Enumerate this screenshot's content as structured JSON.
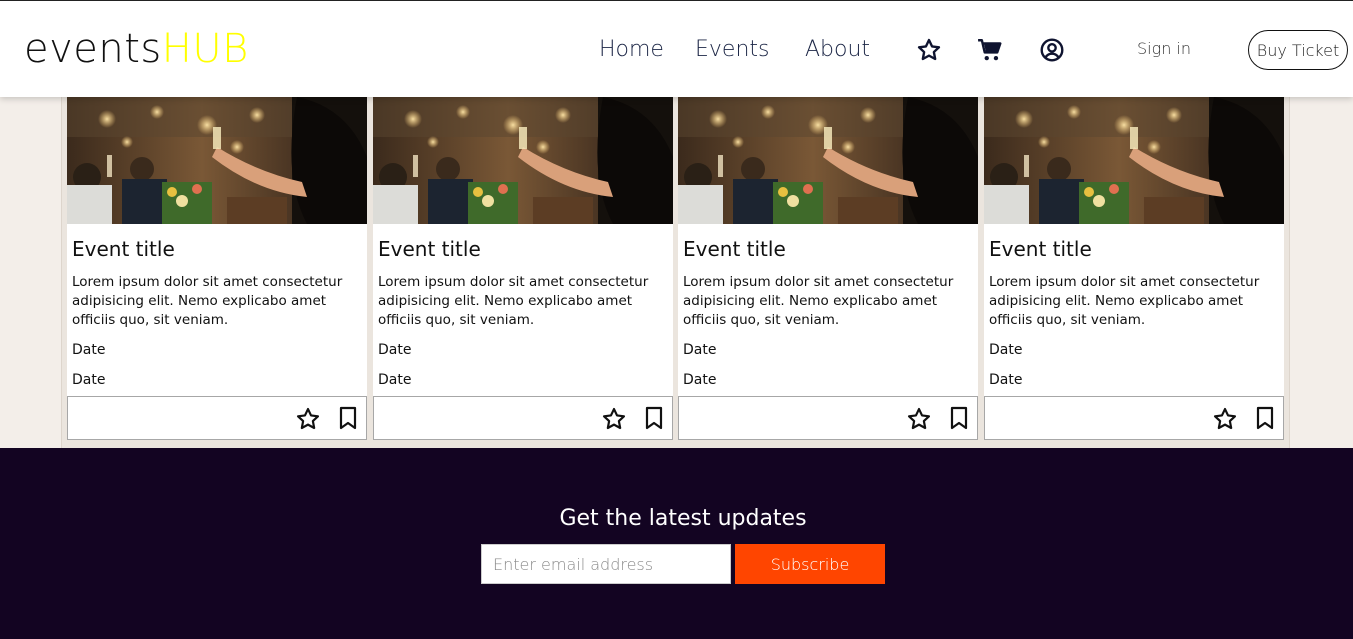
{
  "header": {
    "logo_part1": "events",
    "logo_part2": "HUB",
    "nav": [
      "Home",
      "Events",
      "About"
    ],
    "icons": [
      "star-icon",
      "cart-icon",
      "user-circle-icon"
    ],
    "sign_in": "Sign in",
    "buy_ticket": "Buy Ticket"
  },
  "cards": [
    {
      "title": "Event title",
      "description": "Lorem ipsum dolor sit amet consectetur adipisicing elit. Nemo explicabo amet officiis quo, sit veniam.",
      "date1": "Date",
      "date2": "Date"
    },
    {
      "title": "Event title",
      "description": "Lorem ipsum dolor sit amet consectetur adipisicing elit. Nemo explicabo amet officiis quo, sit veniam.",
      "date1": "Date",
      "date2": "Date"
    },
    {
      "title": "Event title",
      "description": "Lorem ipsum dolor sit amet consectetur adipisicing elit. Nemo explicabo amet officiis quo, sit veniam.",
      "date1": "Date",
      "date2": "Date"
    },
    {
      "title": "Event title",
      "description": "Lorem ipsum dolor sit amet consectetur adipisicing elit. Nemo explicabo amet officiis quo, sit veniam.",
      "date1": "Date",
      "date2": "Date"
    }
  ],
  "footer": {
    "title": "Get the latest updates",
    "email_placeholder": "Enter email address",
    "subscribe": "Subscribe"
  },
  "colors": {
    "logo_accent": "#ffff00",
    "footer_bg": "#130422",
    "subscribe_bg": "#ff4500",
    "nav_text": "#1b2545"
  }
}
